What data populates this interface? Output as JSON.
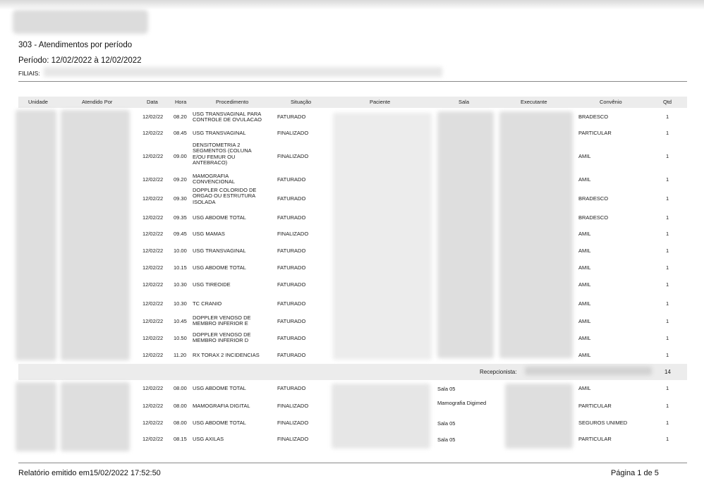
{
  "report": {
    "title": "303 - Atendimentos por período",
    "period": "Período: 12/02/2022 à 12/02/2022",
    "filiais_label": "FILIAIS:"
  },
  "columns": [
    "Unidade",
    "Atendido Por",
    "Data",
    "Hora",
    "Procedimento",
    "Situação",
    "Paciente",
    "Sala",
    "Executante",
    "Convênio",
    "Qtd"
  ],
  "group1": {
    "rows": [
      {
        "data": "12/02/22",
        "hora": "08.20",
        "procedimento": "USG TRANSVAGINAL PARA CONTROLE DE OVULACAO",
        "situacao": "FATURADO",
        "convenio": "BRADESCO",
        "qtd": "1"
      },
      {
        "data": "12/02/22",
        "hora": "08.45",
        "procedimento": "USG TRANSVAGINAL",
        "situacao": "FINALIZADO",
        "convenio": "PARTICULAR",
        "qtd": "1"
      },
      {
        "data": "12/02/22",
        "hora": "09.00",
        "procedimento": "DENSITOMETRIA 2 SEGMENTOS (COLUNA E/OU FEMUR OU ANTEBRACO)",
        "situacao": "FINALIZADO",
        "convenio": "AMIL",
        "qtd": "1"
      },
      {
        "data": "12/02/22",
        "hora": "09.20",
        "procedimento": "MAMOGRAFIA CONVENCIONAL",
        "situacao": "FATURADO",
        "convenio": "AMIL",
        "qtd": "1"
      },
      {
        "data": "12/02/22",
        "hora": "09.30",
        "procedimento": "DOPPLER COLORIDO DE ORGAO OU ESTRUTURA ISOLADA",
        "situacao": "FATURADO",
        "convenio": "BRADESCO",
        "qtd": "1"
      },
      {
        "data": "12/02/22",
        "hora": "09.35",
        "procedimento": "USG ABDOME TOTAL",
        "situacao": "FATURADO",
        "convenio": "BRADESCO",
        "qtd": "1"
      },
      {
        "data": "12/02/22",
        "hora": "09.45",
        "procedimento": "USG MAMAS",
        "situacao": "FINALIZADO",
        "convenio": "AMIL",
        "qtd": "1"
      },
      {
        "data": "12/02/22",
        "hora": "10.00",
        "procedimento": "USG TRANSVAGINAL",
        "situacao": "FATURADO",
        "convenio": "AMIL",
        "qtd": "1"
      },
      {
        "data": "12/02/22",
        "hora": "10.15",
        "procedimento": "USG ABDOME TOTAL",
        "situacao": "FATURADO",
        "convenio": "AMIL",
        "qtd": "1"
      },
      {
        "data": "12/02/22",
        "hora": "10.30",
        "procedimento": "USG TIREOIDE",
        "situacao": "FATURADO",
        "convenio": "AMIL",
        "qtd": "1"
      },
      {
        "data": "12/02/22",
        "hora": "10.30",
        "procedimento": "TC CRANIO",
        "situacao": "FATURADO",
        "convenio": "AMIL",
        "qtd": "1"
      },
      {
        "data": "12/02/22",
        "hora": "10.45",
        "procedimento": "DOPPLER VENOSO DE MEMBRO INFERIOR E",
        "situacao": "FATURADO",
        "convenio": "AMIL",
        "qtd": "1"
      },
      {
        "data": "12/02/22",
        "hora": "10.50",
        "procedimento": "DOPPLER VENOSO DE MEMBRO INFERIOR D",
        "situacao": "FATURADO",
        "convenio": "AMIL",
        "qtd": "1"
      },
      {
        "data": "12/02/22",
        "hora": "11.20",
        "procedimento": "RX TORAX 2 INCIDENCIAS",
        "situacao": "FATURADO",
        "convenio": "AMIL",
        "qtd": "1"
      }
    ],
    "subtotal_label": "Recepcionista:",
    "subtotal_qtd": "14"
  },
  "group2": {
    "rows": [
      {
        "data": "12/02/22",
        "hora": "08.00",
        "procedimento": "USG ABDOME TOTAL",
        "situacao": "FATURADO",
        "sala": "Sala 05",
        "convenio": "AMIL",
        "qtd": "1"
      },
      {
        "data": "12/02/22",
        "hora": "08.00",
        "procedimento": "MAMOGRAFIA DIGITAL",
        "situacao": "FINALIZADO",
        "sala": "Mamografia Digimed",
        "convenio": "PARTICULAR",
        "qtd": "1"
      },
      {
        "data": "12/02/22",
        "hora": "08.00",
        "procedimento": "USG ABDOME TOTAL",
        "situacao": "FINALIZADO",
        "sala": "Sala 05",
        "convenio": "SEGUROS UNIMED",
        "qtd": "1"
      },
      {
        "data": "12/02/22",
        "hora": "08.15",
        "procedimento": "USG AXILAS",
        "situacao": "FINALIZADO",
        "sala": "Sala 05",
        "convenio": "PARTICULAR",
        "qtd": "1"
      }
    ]
  },
  "footer": {
    "emitted": "Relatório emitido em15/02/2022 17:52:50",
    "page": "Página 1 de 5"
  }
}
